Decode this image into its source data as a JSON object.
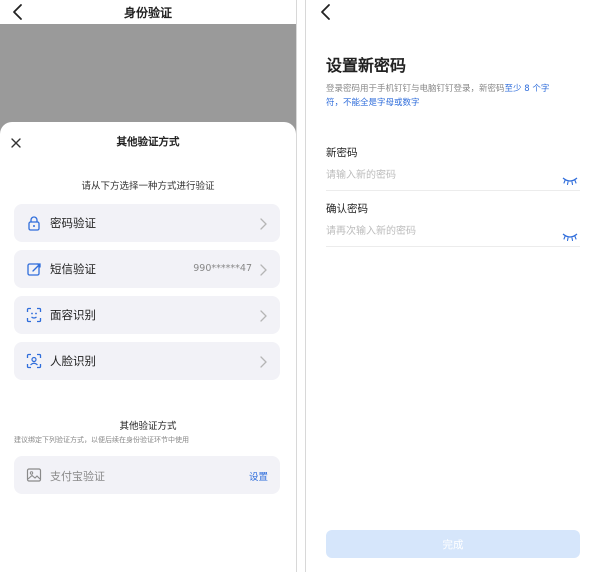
{
  "left": {
    "title": "身份验证",
    "sheet": {
      "title": "其他验证方式",
      "prompt": "请从下方选择一种方式进行验证",
      "options": [
        {
          "label": "密码验证",
          "value": "",
          "icon": "lock-icon"
        },
        {
          "label": "短信验证",
          "value": "990******47",
          "icon": "sms-icon"
        },
        {
          "label": "面容识别",
          "value": "",
          "icon": "face-scan-icon"
        },
        {
          "label": "人脸识别",
          "value": "",
          "icon": "face-recognition-icon"
        }
      ],
      "other_heading": "其他验证方式",
      "other_note": "建议绑定下列验证方式，以便后续在身份验证环节中使用",
      "alipay": {
        "label": "支付宝验证",
        "action": "设置",
        "icon": "image-icon"
      }
    }
  },
  "right": {
    "title": "设置新密码",
    "desc_plain": "登录密码用于手机钉钉与电脑钉钉登录，新密码",
    "desc_hl1": "至少 8 个字",
    "desc_hl2": "符，不能全是字母或数字",
    "new_password": {
      "label": "新密码",
      "placeholder": "请输入新的密码"
    },
    "confirm_password": {
      "label": "确认密码",
      "placeholder": "请再次输入新的密码"
    },
    "done_label": "完成"
  },
  "colors": {
    "accent": "#2f6ddb",
    "option_bg": "#f2f2f7",
    "overlay": "#9a9a9a",
    "done_bg": "#d6e6fb"
  }
}
